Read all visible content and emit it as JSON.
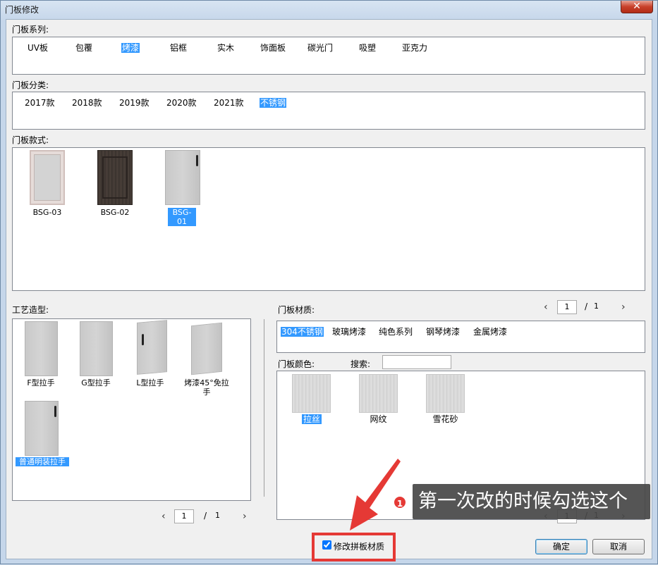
{
  "window": {
    "title": "门板修改",
    "close_label": "✕"
  },
  "series": {
    "label": "门板系列:",
    "items": [
      "UV板",
      "包覆",
      "烤漆",
      "铝框",
      "实木",
      "饰面板",
      "碳光门",
      "吸塑",
      "亚克力"
    ],
    "selected": "烤漆"
  },
  "category": {
    "label": "门板分类:",
    "items": [
      "2017款",
      "2018款",
      "2019款",
      "2020款",
      "2021款",
      "不锈钢"
    ],
    "selected": "不锈钢"
  },
  "style": {
    "label": "门板款式:",
    "items": [
      "BSG-03",
      "BSG-02",
      "BSG-01"
    ],
    "selected": "BSG-01"
  },
  "craft": {
    "label": "工艺造型:",
    "items": [
      "F型拉手",
      "G型拉手",
      "L型拉手",
      "烤漆45°免拉手",
      "普通明装拉手"
    ],
    "selected": "普通明装拉手",
    "pager": {
      "prev": "‹",
      "page": "1",
      "slash": "/",
      "total": "1",
      "next": "›"
    }
  },
  "material": {
    "label": "门板材质:",
    "items": [
      "304不锈钢",
      "玻璃烤漆",
      "纯色系列",
      "钢琴烤漆",
      "金属烤漆"
    ],
    "selected": "304不锈钢",
    "pager": {
      "prev": "‹",
      "page": "1",
      "slash": "/",
      "total": "1",
      "next": "›"
    }
  },
  "color": {
    "label": "门板颜色:",
    "search_label": "搜索:",
    "search_value": "",
    "items": [
      "拉丝",
      "网纹",
      "雪花砂"
    ],
    "selected": "拉丝",
    "pager": {
      "prev": "‹",
      "page": "1",
      "slash": "/",
      "total": "1",
      "next": "›"
    }
  },
  "footer": {
    "checkbox_label": "修改拼板材质",
    "checkbox_checked": true,
    "ok_label": "确定",
    "cancel_label": "取消"
  },
  "annotation": {
    "badge": "1",
    "text": "第一次改的时候勾选这个",
    "accent": "#e53935"
  }
}
